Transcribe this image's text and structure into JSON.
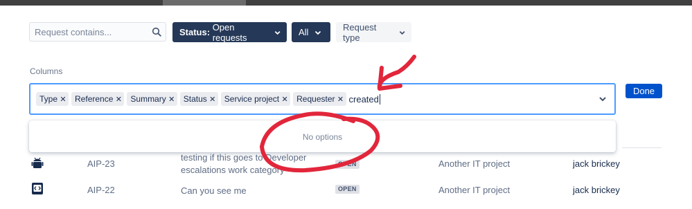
{
  "filters": {
    "search_placeholder": "Request contains...",
    "status_prefix": "Status:",
    "status_value": "Open requests",
    "all_label": "All",
    "request_type_label": "Request type"
  },
  "columns": {
    "label": "Columns",
    "tags": [
      "Type",
      "Reference",
      "Summary",
      "Status",
      "Service project",
      "Requester"
    ],
    "typed_value": "created",
    "no_options": "No options",
    "done_label": "Done"
  },
  "rows": [
    {
      "reference": "AIP-23",
      "summary_line1": "testing if this goes to Developer",
      "summary_line2": "escalations work category",
      "status": "OPEN",
      "project": "Another IT project",
      "requester": "jack brickey",
      "type_icon": "android-icon"
    },
    {
      "reference": "AIP-22",
      "summary_line1": "Can you see me",
      "summary_line2": "",
      "status": "OPEN",
      "project": "Another IT project",
      "requester": "jack brickey",
      "type_icon": "code-icon"
    }
  ],
  "colors": {
    "dark_button": "#253858",
    "primary": "#0052cc",
    "focus_border": "#4c9aff",
    "annotation_red": "#e2263b"
  }
}
